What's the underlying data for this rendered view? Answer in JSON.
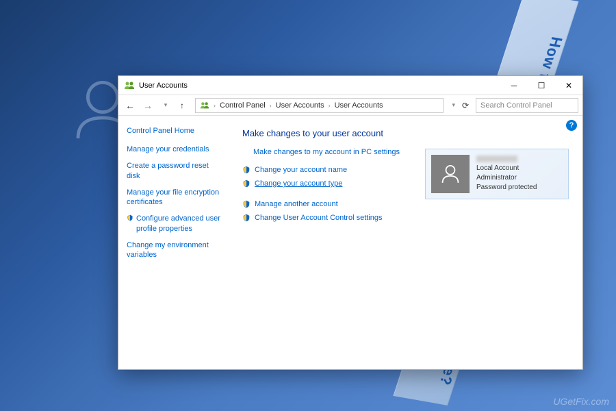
{
  "window": {
    "title": "User Accounts"
  },
  "breadcrumb": {
    "items": [
      "Control Panel",
      "User Accounts",
      "User Accounts"
    ]
  },
  "search": {
    "placeholder": "Search Control Panel"
  },
  "sidebar": {
    "home": "Control Panel Home",
    "links": [
      "Manage your credentials",
      "Create a password reset disk",
      "Manage your file encryption certificates",
      "Configure advanced user profile properties",
      "Change my environment variables"
    ]
  },
  "main": {
    "heading": "Make changes to your user account",
    "pc_settings_link": "Make changes to my account in PC settings",
    "actions": [
      "Change your account name",
      "Change your account type"
    ],
    "secondary_actions": [
      "Manage another account",
      "Change User Account Control settings"
    ]
  },
  "account": {
    "type": "Local Account",
    "role": "Administrator",
    "protection": "Password protected"
  },
  "ribbon_text": "How to Change Microsoft User Account Name?",
  "watermark": "UGetFix.com"
}
